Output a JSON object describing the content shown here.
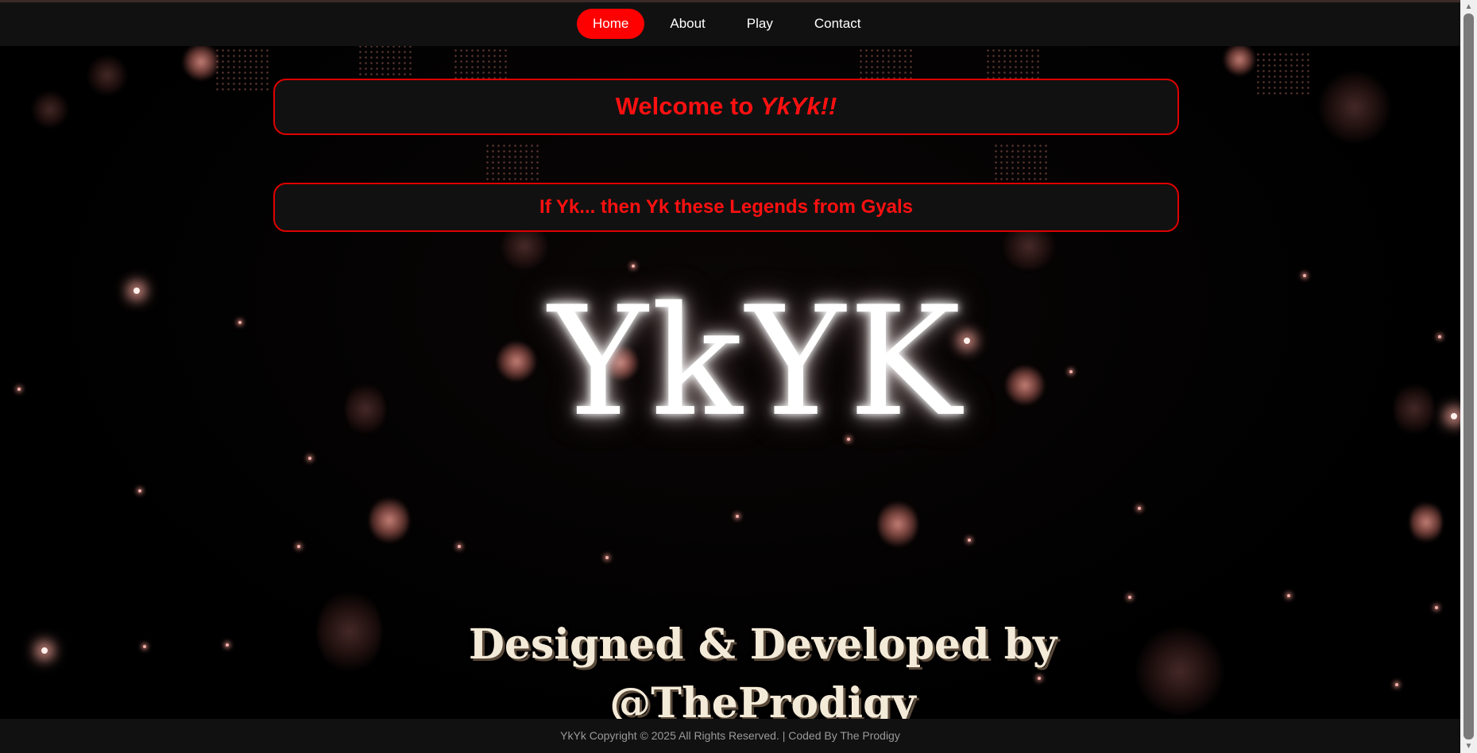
{
  "nav": {
    "items": [
      {
        "label": "Home",
        "active": true
      },
      {
        "label": "About",
        "active": false
      },
      {
        "label": "Play",
        "active": false
      },
      {
        "label": "Contact",
        "active": false
      }
    ]
  },
  "hero": {
    "welcome_prefix": "Welcome to ",
    "welcome_brand": "YkYk!!",
    "subtitle": "If Yk... then Yk these Legends from Gyals",
    "logo": "YkYK"
  },
  "credit": {
    "line1": "Designed & Developed by",
    "line2": "@TheProdigy"
  },
  "footer": {
    "text": "YkYk Copyright © 2025 All Rights Reserved. | Coded By The Prodigy"
  },
  "colors": {
    "accent": "#ff0000",
    "navbar_bg": "#111111",
    "page_bg": "#000000"
  },
  "icons": {
    "scroll_up": "chevron-up-icon",
    "scroll_down": "chevron-down-icon"
  }
}
